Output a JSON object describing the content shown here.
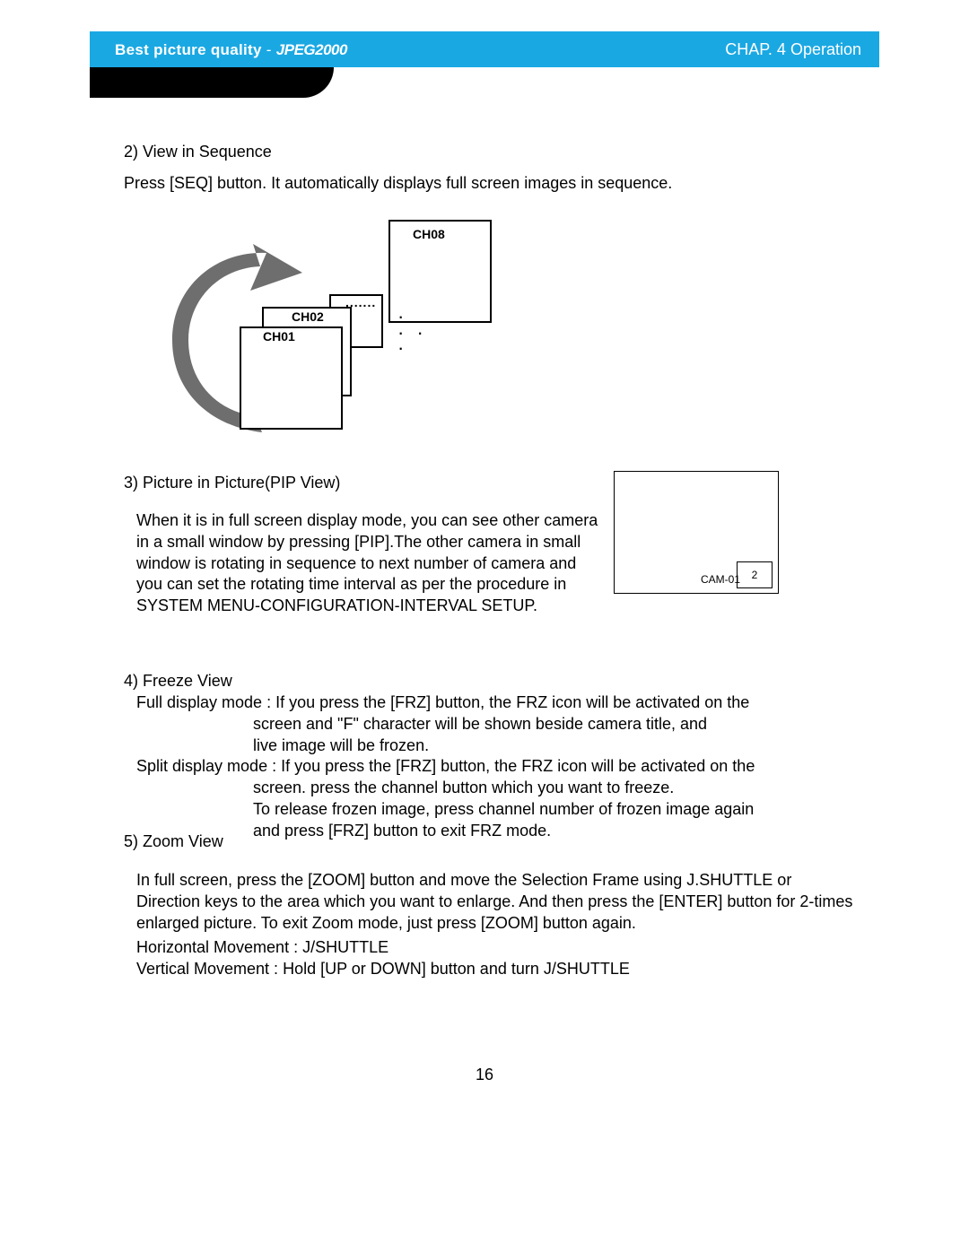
{
  "header": {
    "left_a": "Best picture quality",
    "dash": " - ",
    "logo": "JPEG2000",
    "right": "CHAP. 4   Operation"
  },
  "sec2": {
    "title": "2) View in Sequence",
    "body": "Press [SEQ] button. It automatically displays full screen images in sequence."
  },
  "diagram": {
    "ch08": "CH08",
    "dots": ".......",
    "ch02": "CH02",
    "ch01": "CH01",
    "bigdots": "·\n· ·\n·"
  },
  "sec3": {
    "title": "3) Picture in Picture(PIP View)",
    "body": "When it is in full screen display mode, you can see other camera in a small window by pressing [PIP].The other camera in small window is rotating in sequence to next number of camera and you can set the rotating time interval as per the procedure in SYSTEM MENU-CONFIGURATION-INTERVAL SETUP.",
    "pip_label": "CAM-01",
    "pip_small": "2"
  },
  "sec4": {
    "title": "4) Freeze View",
    "l1": "Full display mode : If you press the [FRZ] button, the FRZ icon will be activated on the",
    "l2": "screen and \"F\" character will be shown beside camera title, and",
    "l3": "live image will be frozen.",
    "l4": "Split display mode : If you press the [FRZ] button, the FRZ icon will be activated on the",
    "l5": "screen. press the channel button which you want to freeze.",
    "l6": "To release frozen image, press channel number of frozen image again",
    "l7": "and press [FRZ] button to exit FRZ mode."
  },
  "sec5": {
    "title": "5) Zoom View",
    "body": "In full screen, press the [ZOOM] button and move the Selection Frame using J.SHUTTLE or Direction keys to the area which you want to enlarge. And then press the [ENTER] button for 2-times enlarged picture. To exit Zoom mode, just press [ZOOM] button again.",
    "hm": "Horizontal Movement : J/SHUTTLE",
    "vm": "Vertical  Movement : Hold [UP or DOWN] button and turn J/SHUTTLE"
  },
  "page_number": "16"
}
